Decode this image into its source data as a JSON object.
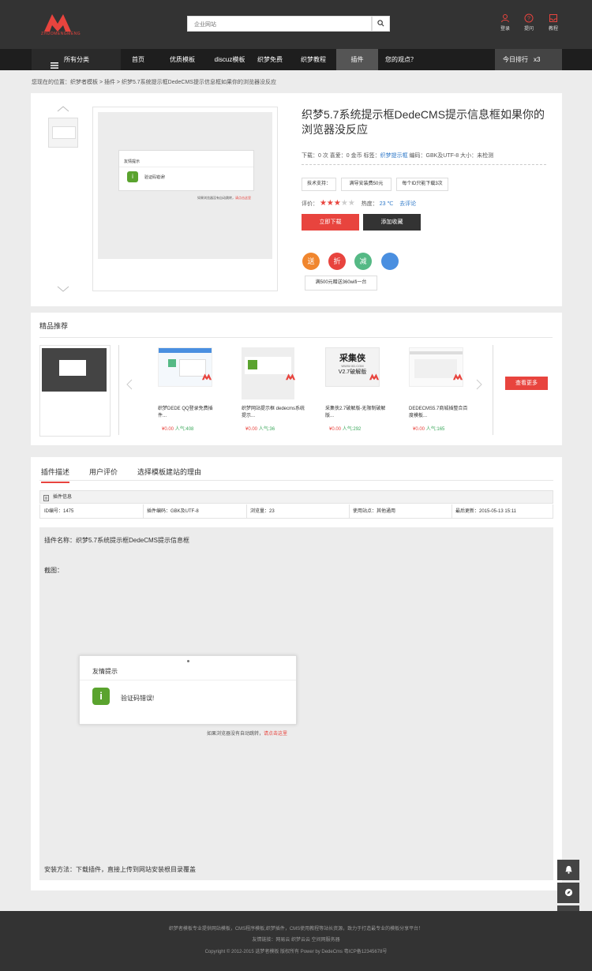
{
  "header": {
    "logo_text": "ZHUOMENGMENG",
    "search_placeholder": "企业网站",
    "icons": [
      {
        "name": "user-icon",
        "label": "登录"
      },
      {
        "name": "help-icon",
        "label": "提问"
      },
      {
        "name": "inbox-icon",
        "label": "教程"
      }
    ]
  },
  "nav": {
    "category": "所有分类",
    "items": [
      "首页",
      "优质模板",
      "discuz模板",
      "织梦免费",
      "织梦教程",
      "插件",
      "您的观点？"
    ],
    "rank_label": "今日排行",
    "rank_count": "x3"
  },
  "breadcrumb": "您现在的位置：织梦者模板 > 插件 > 织梦5.7系统提示框DedeCMS提示信息框如果你的浏览器没反应",
  "product": {
    "title": "织梦5.7系统提示框DedeCMS提示信息框如果你的浏览器没反应",
    "meta_prefix": "下载：0 次  喜爱：0 金币  标签：",
    "meta_link": "织梦提示框",
    "meta_suffix": "  编码：GBK及UTF-8  大小：未检测",
    "tags": [
      "技术支持：",
      "满导安装费50元",
      "每个ID只能下载3次"
    ],
    "rating_label": "评价：",
    "rating": 3,
    "rating_max": 5,
    "heat_label": "热度：",
    "heat_value": "23 ℃",
    "heat_link": "去评论",
    "download_btn": "立即下载",
    "fav_btn": "添加收藏",
    "circles": [
      {
        "text": "送",
        "color": "#f0862e"
      },
      {
        "text": "折",
        "color": "#e8443e"
      },
      {
        "text": "减",
        "color": "#55b985"
      },
      {
        "text": "",
        "color": "#4a8fe0"
      }
    ],
    "promo": "满500元赠送360wifi一台",
    "dialog_title": "友情提示",
    "dialog_msg": "验证码错误!",
    "dialog_footer_a": "如果浏览器没有自动跳转，",
    "dialog_footer_b": "请点击这里"
  },
  "recommend": {
    "title": "精品推荐",
    "items": [
      {
        "name": "织梦DEDE QQ登录免费插件...",
        "price": "¥0.00",
        "hot": "人气:408"
      },
      {
        "name": "织梦网站提示框 dedecms系统提示...",
        "price": "¥0.00",
        "hot": "人气:36"
      },
      {
        "name": "采集侠2.7破解版-无限制破解版...",
        "price": "¥0.00",
        "hot": "人气:292"
      },
      {
        "name": "DEDECMS5.7商城插整合百度模板...",
        "price": "¥0.00",
        "hot": "人气:165"
      }
    ],
    "caiji_title": "采集侠",
    "caiji_sub": "V2.7破解版",
    "caiji_url": "WWW.XD.COM",
    "view_more": "查看更多"
  },
  "tabs": [
    "插件描述",
    "用户评价",
    "选择模板建站的理由"
  ],
  "info": {
    "head": "插件信息",
    "cells": [
      "ID编号：1475",
      "插件编码：GBK及UTF-8",
      "浏览量：23",
      "使用站点：其他通用",
      "最后更新：2015-05-13 15:11"
    ]
  },
  "content": {
    "name_line": "插件名称：织梦5.7系统提示框DedeCMS提示信息框",
    "screenshot_label": "截图：",
    "install": "安装方法：下载插件，直接上传到网站安装根目录覆盖"
  },
  "footer": {
    "line1": "织梦者模板专业提供网站模板，CMS程序模板,织梦插件，CMS使用教程等站长资源，致力于打造最专业的模板分享平台！",
    "line2": "友情链接：网易云   织梦云云   空间网服务器",
    "line3": "Copyright © 2012-2015 选梦者模板 版权所有 Power by DedeCms  粤ICP备12345678号"
  },
  "colors": {
    "accent": "#e8443e",
    "dark": "#333333",
    "nav": "#1e1e1e",
    "link": "#2e78c8",
    "hot": "#3ca85c"
  }
}
